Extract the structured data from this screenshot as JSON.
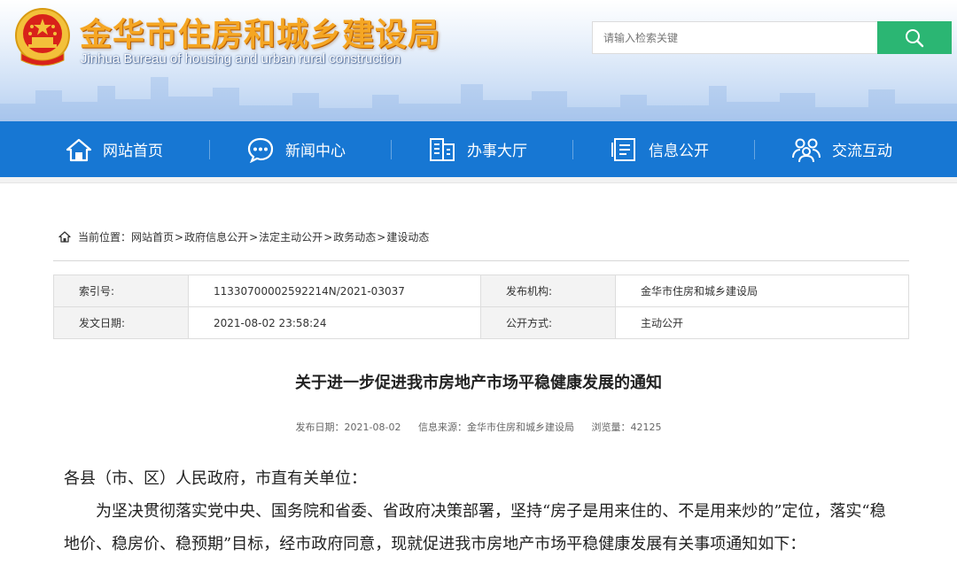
{
  "header": {
    "title": "金华市住房和城乡建设局",
    "subtitle": "Jinhua Bureau of housing and urban rural construction",
    "search_placeholder": "请输入检索关键",
    "brand_orange": "#f5a623",
    "search_green": "#2bb673"
  },
  "nav": {
    "color": "#1777d3",
    "items": [
      {
        "label": "网站首页",
        "icon": "home-icon"
      },
      {
        "label": "新闻中心",
        "icon": "chat-bubble-icon"
      },
      {
        "label": "办事大厅",
        "icon": "office-icon"
      },
      {
        "label": "信息公开",
        "icon": "document-icon"
      },
      {
        "label": "交流互动",
        "icon": "people-icon"
      }
    ]
  },
  "breadcrumb": {
    "prefix": "当前位置：",
    "items": [
      "网站首页",
      "政府信息公开",
      "法定主动公开",
      "政务动态",
      "建设动态"
    ],
    "sep": ">"
  },
  "meta": {
    "index_label": "索引号:",
    "index_value": "11330700002592214N/2021-03037",
    "org_label": "发布机构:",
    "org_value": "金华市住房和城乡建设局",
    "date_label": "发文日期:",
    "date_value": "2021-08-02 23:58:24",
    "mode_label": "公开方式:",
    "mode_value": "主动公开"
  },
  "article": {
    "title": "关于进一步促进我市房地产市场平稳健康发展的通知",
    "publish_date": "发布日期：2021-08-02",
    "source": "信息来源：金华市住房和城乡建设局",
    "views": "浏览量：42125",
    "salutation": "各县（市、区）人民政府，市直有关单位：",
    "para1": "为坚决贯彻落实党中央、国务院和省委、省政府决策部署，坚持“房子是用来住的、不是用来炒的”定位，落实“稳地价、稳房价、稳预期”目标，经市政府同意，现就促进我市房地产市场平稳健康发展有关事项通知如下："
  }
}
